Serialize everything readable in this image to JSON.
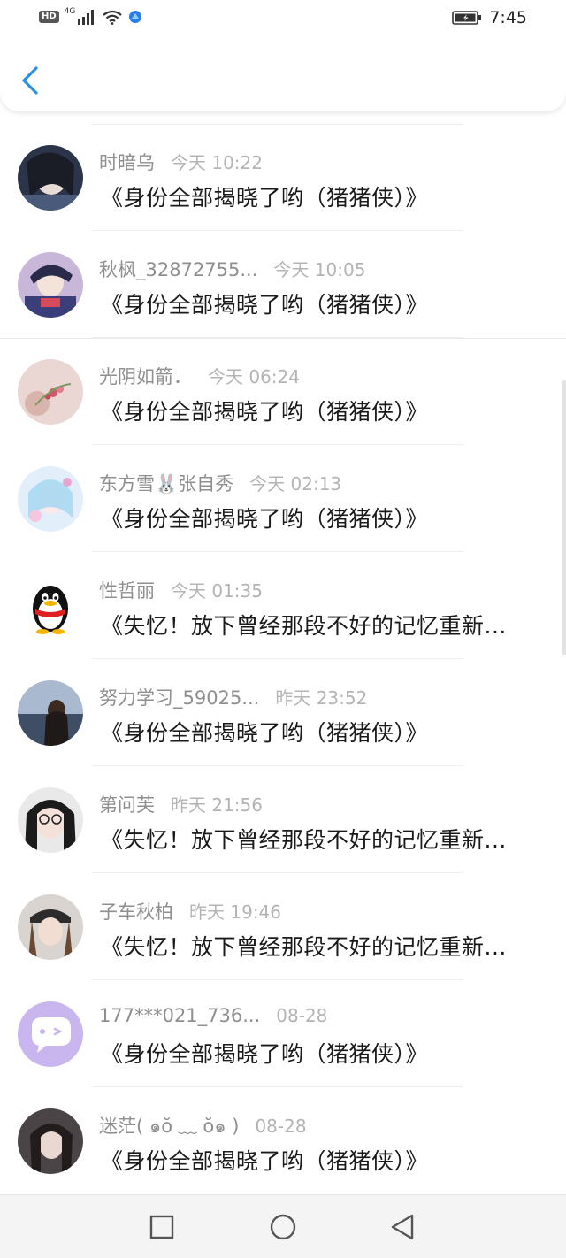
{
  "status_bar": {
    "left_badge": "HD",
    "network": "4G",
    "time": "7:45"
  },
  "header": {
    "back_icon": "chevron-left-icon"
  },
  "items": [
    {
      "name": "时暗乌",
      "time": "今天 10:22",
      "title": "《身份全部揭晓了哟（猪猪侠）》",
      "avatar": "anime-girl-dark-avatar"
    },
    {
      "name": "秋枫_32872755...",
      "time": "今天 10:05",
      "title": "《身份全部揭晓了哟（猪猪侠）》",
      "avatar": "anime-boy-avatar"
    },
    {
      "name": "光阴如箭．",
      "time": "今天 06:24",
      "title": "《身份全部揭晓了哟（猪猪侠）》",
      "avatar": "pink-flower-avatar"
    },
    {
      "name": "东方雪🐰张自秀",
      "time": "今天 02:13",
      "title": "《身份全部揭晓了哟（猪猪侠）》",
      "avatar": "pastel-anime-avatar"
    },
    {
      "name": "性哲丽",
      "time": "今天 01:35",
      "title": "《失忆！放下曾经那段不好的记忆重新...",
      "avatar": "qq-penguin-avatar"
    },
    {
      "name": "努力学习_59025...",
      "time": "昨天 23:52",
      "title": "《身份全部揭晓了哟（猪猪侠）》",
      "avatar": "sea-girl-avatar"
    },
    {
      "name": "第问芙",
      "time": "昨天 21:56",
      "title": "《失忆！放下曾经那段不好的记忆重新...",
      "avatar": "glasses-girl-avatar"
    },
    {
      "name": "子车秋柏",
      "time": "昨天 19:46",
      "title": "《失忆！放下曾经那段不好的记忆重新...",
      "avatar": "cap-girl-avatar"
    },
    {
      "name": "177***021_736...",
      "time": "08-28",
      "title": "《身份全部揭晓了哟（猪猪侠）》",
      "avatar": "purple-chat-avatar"
    },
    {
      "name": "迷茫( ๑ŏ ﹏ ŏ๑ )",
      "time": "08-28",
      "title": "《身份全部揭晓了哟（猪猪侠）》",
      "avatar": "dark-girl-avatar"
    }
  ],
  "nav": {
    "recent_icon": "square-icon",
    "home_icon": "circle-icon",
    "back_icon": "triangle-back-icon"
  },
  "colors": {
    "accent": "#2b8fe6",
    "name_text": "#8f8f8f",
    "time_text": "#b4b4b4",
    "title_text": "#1a1a1a"
  }
}
